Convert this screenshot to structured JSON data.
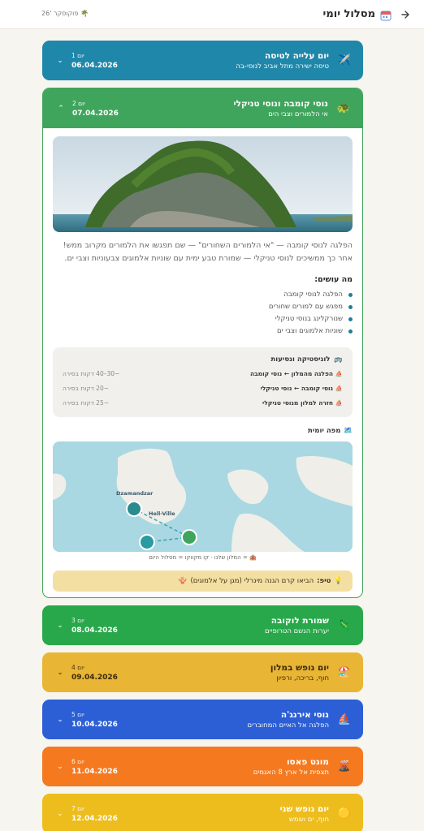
{
  "header": {
    "title": "מסלול יומי",
    "brand": "פוקוסקר '26",
    "back_icon": "arrow-right-icon",
    "calendar_icon": "calendar-icon",
    "palm_icon": "palm-tree-icon"
  },
  "days": [
    {
      "day_label": "יום 1",
      "date": "06.04.2026",
      "title": "יום עלייה לטיסה",
      "subtitle": "טיסה ישירה מתל אביב לנוסי-בה",
      "icon": "✈️",
      "color": "#1f87a9"
    },
    {
      "day_label": "יום 2",
      "date": "07.04.2026",
      "title": "נוסי קומבה ונוסי טניקלי",
      "subtitle": "אי הלמורים וצבי הים",
      "icon": "🐢",
      "color": "#3fa55c"
    },
    {
      "day_label": "יום 3",
      "date": "08.04.2026",
      "title": "שמורת לוקובה",
      "subtitle": "יערות הגשם הטרופיים",
      "icon": "🦎",
      "color": "#28a84a"
    },
    {
      "day_label": "יום 4",
      "date": "09.04.2026",
      "title": "יום נופש במלון",
      "subtitle": "חוף, בריכה, ורפיון",
      "icon": "🏖️",
      "color": "#e9b534"
    },
    {
      "day_label": "יום 5",
      "date": "10.04.2026",
      "title": "נוסי אירנג'ה",
      "subtitle": "הפלגה אל האיים המחוברים",
      "icon": "⛵",
      "color": "#2c5fd6"
    },
    {
      "day_label": "יום 6",
      "date": "11.04.2026",
      "title": "מונט פאסו",
      "subtitle": "תצפית אל ארץ 8 האגמים",
      "icon": "🌋",
      "color": "#f5791f"
    },
    {
      "day_label": "יום 7",
      "date": "12.04.2026",
      "title": "יום נופש שני",
      "subtitle": "חוף, ים ושמש",
      "icon": "🟡",
      "color": "#edbd1e"
    }
  ],
  "expanded": {
    "description": "הפלגה לנוסי קומבה — \"אי הלמורים השחורים\" — שם תפגשו את הלמורים מקרוב ממש! אחר כך ממשיכים לנוסי טניקלי — שמורת טבע ימית עם שוניות אלמוגים צבעוניות וצבי ים.",
    "activities_title": "מה עושים:",
    "activities": [
      "הפלגה לנוסי קומבה",
      "מפגש עם למורים שחורים",
      "שנורקלינג בנוסי טניקלי",
      "שוניות אלמוגים וצבי ים"
    ],
    "logistics_title": "לוגיסטיקה ונסיעות",
    "logistics": [
      {
        "route": "הפלגה מהמלון ← נוסי קומבה",
        "duration": "~30–40 דקות בסירה"
      },
      {
        "route": "נוסי קומבה ← נוסי טניקלי",
        "duration": "~20 דקות בסירה"
      },
      {
        "route": "חזרה למלון מנוסי טניקלי",
        "duration": "~25 דקות בסירה"
      }
    ],
    "map_title": "מפה יומית",
    "map_labels": {
      "town1": "Dzamandzar",
      "town2": "Hell-Ville"
    },
    "map_legend": "🏨 = המלון שלנו · קו מקווקו = מסלול היום",
    "tip_label": "טיפ:",
    "tip_text": "הביאו קרם הגנה מינרלי (מגן על אלמוגים)"
  }
}
